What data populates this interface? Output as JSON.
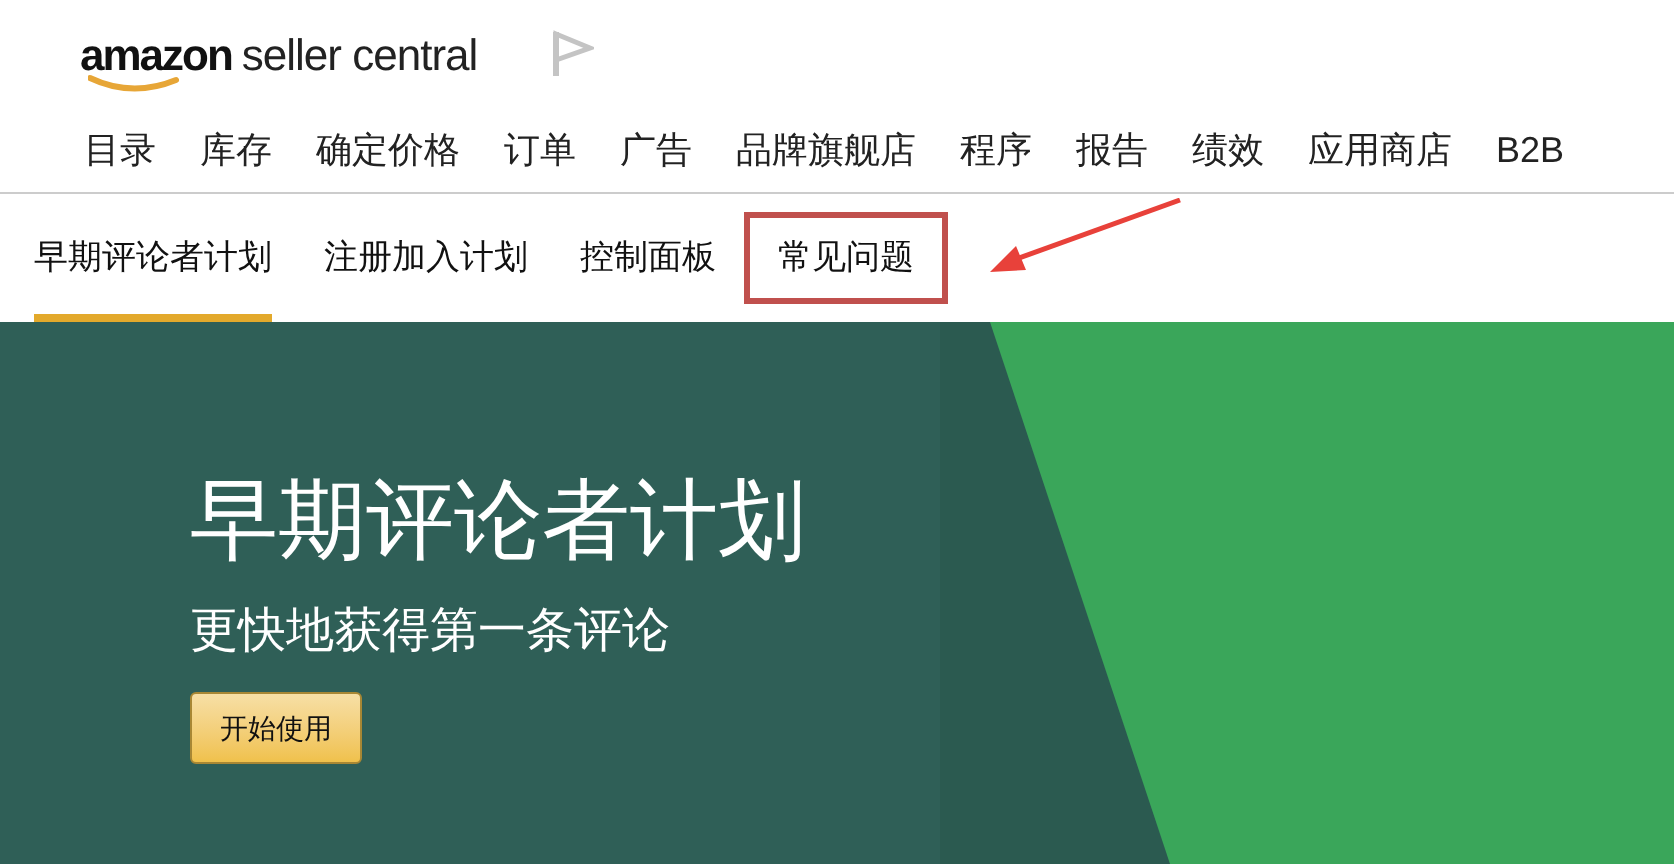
{
  "logo": {
    "brand": "amazon",
    "product": "seller central"
  },
  "nav": [
    "目录",
    "库存",
    "确定价格",
    "订单",
    "广告",
    "品牌旗舰店",
    "程序",
    "报告",
    "绩效",
    "应用商店",
    "B2B"
  ],
  "subtabs": [
    {
      "label": "早期评论者计划",
      "selected": true,
      "highlighted": false
    },
    {
      "label": "注册加入计划",
      "selected": false,
      "highlighted": false
    },
    {
      "label": "控制面板",
      "selected": false,
      "highlighted": false
    },
    {
      "label": "常见问题",
      "selected": false,
      "highlighted": true
    }
  ],
  "hero": {
    "title": "早期评论者计划",
    "subtitle": "更快地获得第一条评论",
    "button": "开始使用"
  }
}
